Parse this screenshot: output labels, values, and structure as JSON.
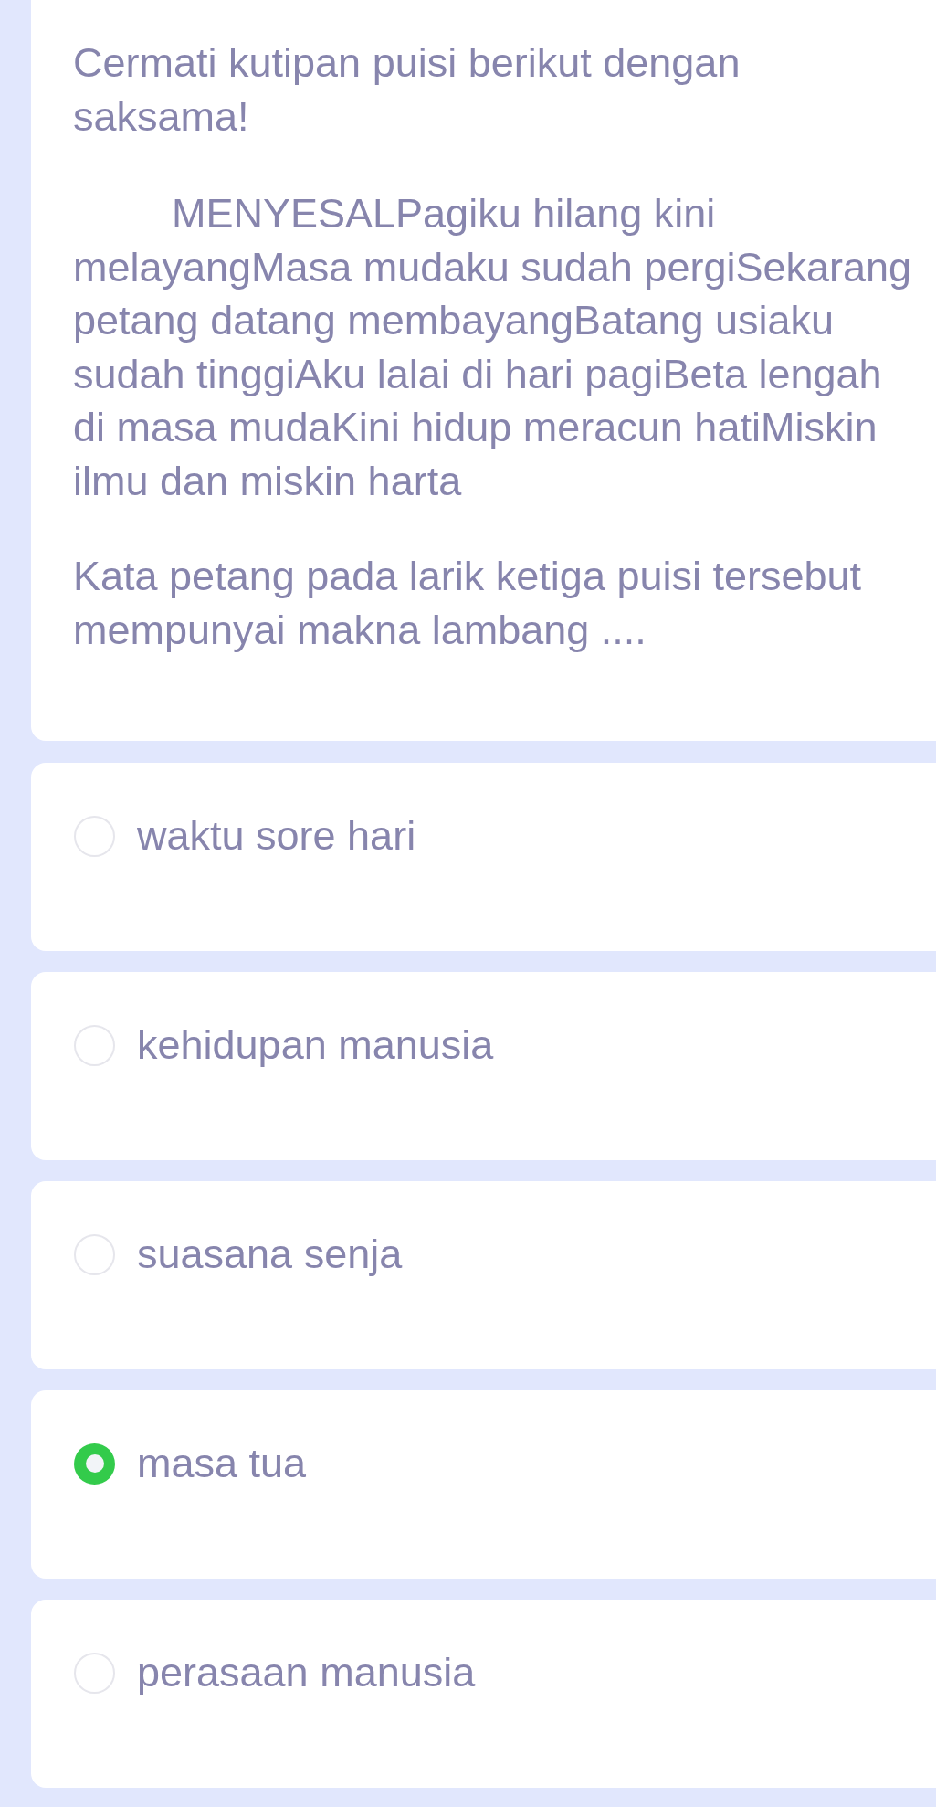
{
  "question_card": {
    "instruction": "Cermati kutipan puisi berikut dengan saksama!",
    "poem": "MENYESALPagiku hilang kini melayangMasa mudaku sudah pergiSekarang petang datang membayangBatang usiaku sudah tinggiAku lalai di hari pagiBeta lengah di masa mudaKini hidup meracun hatiMiskin ilmu dan miskin harta",
    "question": "Kata petang pada larik ketiga puisi tersebut mempunyai makna lambang ...."
  },
  "options": [
    {
      "label": "waktu sore hari",
      "selected": false
    },
    {
      "label": "kehidupan manusia",
      "selected": false
    },
    {
      "label": "suasana senja",
      "selected": false
    },
    {
      "label": "masa tua",
      "selected": true
    },
    {
      "label": "perasaan manusia",
      "selected": false
    }
  ]
}
